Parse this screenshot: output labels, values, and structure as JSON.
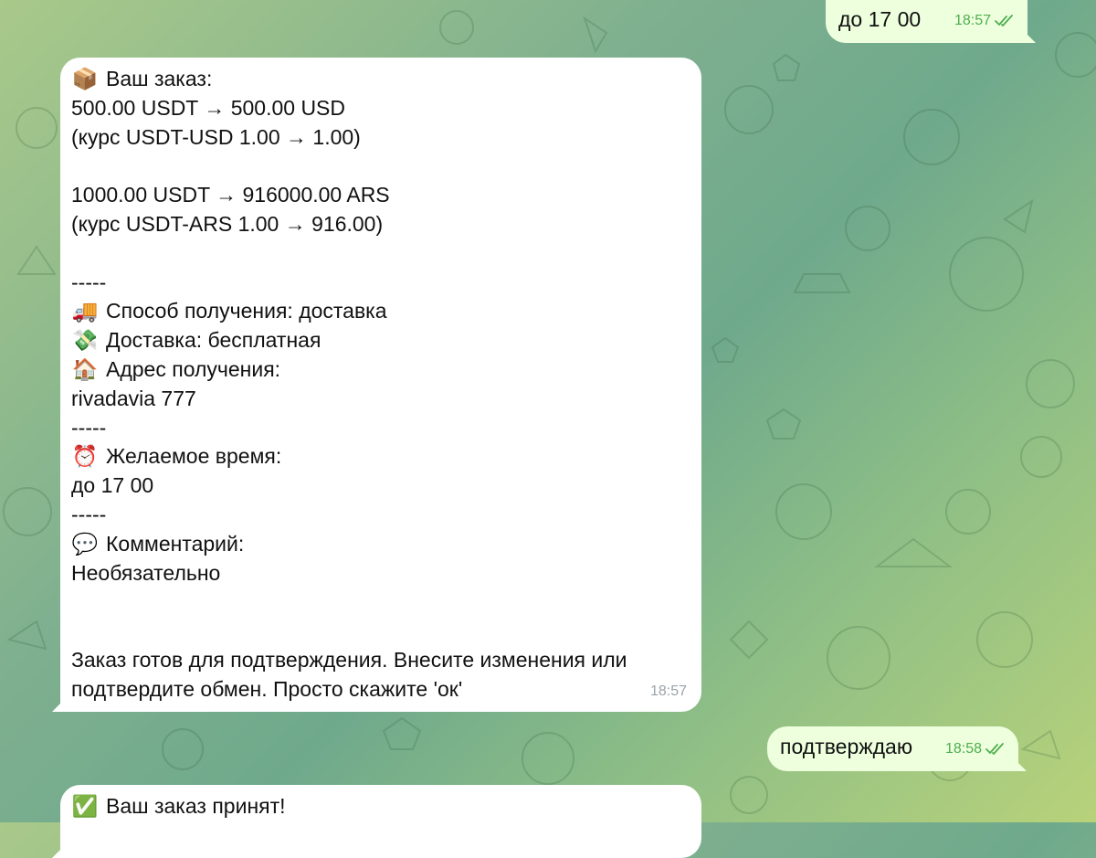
{
  "messages": [
    {
      "id": "msg1",
      "direction": "outgoing",
      "text": "до 17 00",
      "time": "18:57",
      "status": "read"
    },
    {
      "id": "msg2",
      "direction": "incoming",
      "lines": [
        {
          "icon": "📦",
          "icon_name": "package-icon",
          "text": "Ваш заказ:"
        },
        {
          "text": "500.00 USDT → 500.00 USD"
        },
        {
          "text": "(курс USDT-USD 1.00 → 1.00)"
        },
        {
          "text": ""
        },
        {
          "text": "1000.00 USDT → 916000.00 ARS"
        },
        {
          "text": "(курс USDT-ARS 1.00 → 916.00)"
        },
        {
          "text": ""
        },
        {
          "text": "-----"
        },
        {
          "icon": "🚚",
          "icon_name": "truck-icon",
          "text": "Способ получения: доставка"
        },
        {
          "icon": "💸",
          "icon_name": "money-wings-icon",
          "text": "Доставка: бесплатная"
        },
        {
          "icon": "🏠",
          "icon_name": "house-icon",
          "text": "Адрес получения:"
        },
        {
          "text": "rivadavia 777"
        },
        {
          "text": "-----"
        },
        {
          "icon": "⏰",
          "icon_name": "alarm-clock-icon",
          "text": "Желаемое время:"
        },
        {
          "text": "до 17 00"
        },
        {
          "text": "-----"
        },
        {
          "icon": "💬",
          "icon_name": "speech-bubble-icon",
          "text": "Комментарий:"
        },
        {
          "text": "Необязательно"
        },
        {
          "text": ""
        },
        {
          "text": ""
        },
        {
          "text": "Заказ готов для подтверждения. Внесите изменения или"
        },
        {
          "text": "подтвердите обмен. Просто скажите 'ок'"
        }
      ],
      "time": "18:57"
    },
    {
      "id": "msg3",
      "direction": "outgoing",
      "text": "подтверждаю",
      "time": "18:58",
      "status": "read"
    },
    {
      "id": "msg4",
      "direction": "incoming",
      "lines": [
        {
          "icon": "✅",
          "icon_name": "check-mark-icon",
          "text": "Ваш заказ принят!"
        }
      ]
    }
  ],
  "colors": {
    "incoming_bubble": "#ffffff",
    "outgoing_bubble": "#eeffde",
    "read_check": "#4fae4e"
  }
}
